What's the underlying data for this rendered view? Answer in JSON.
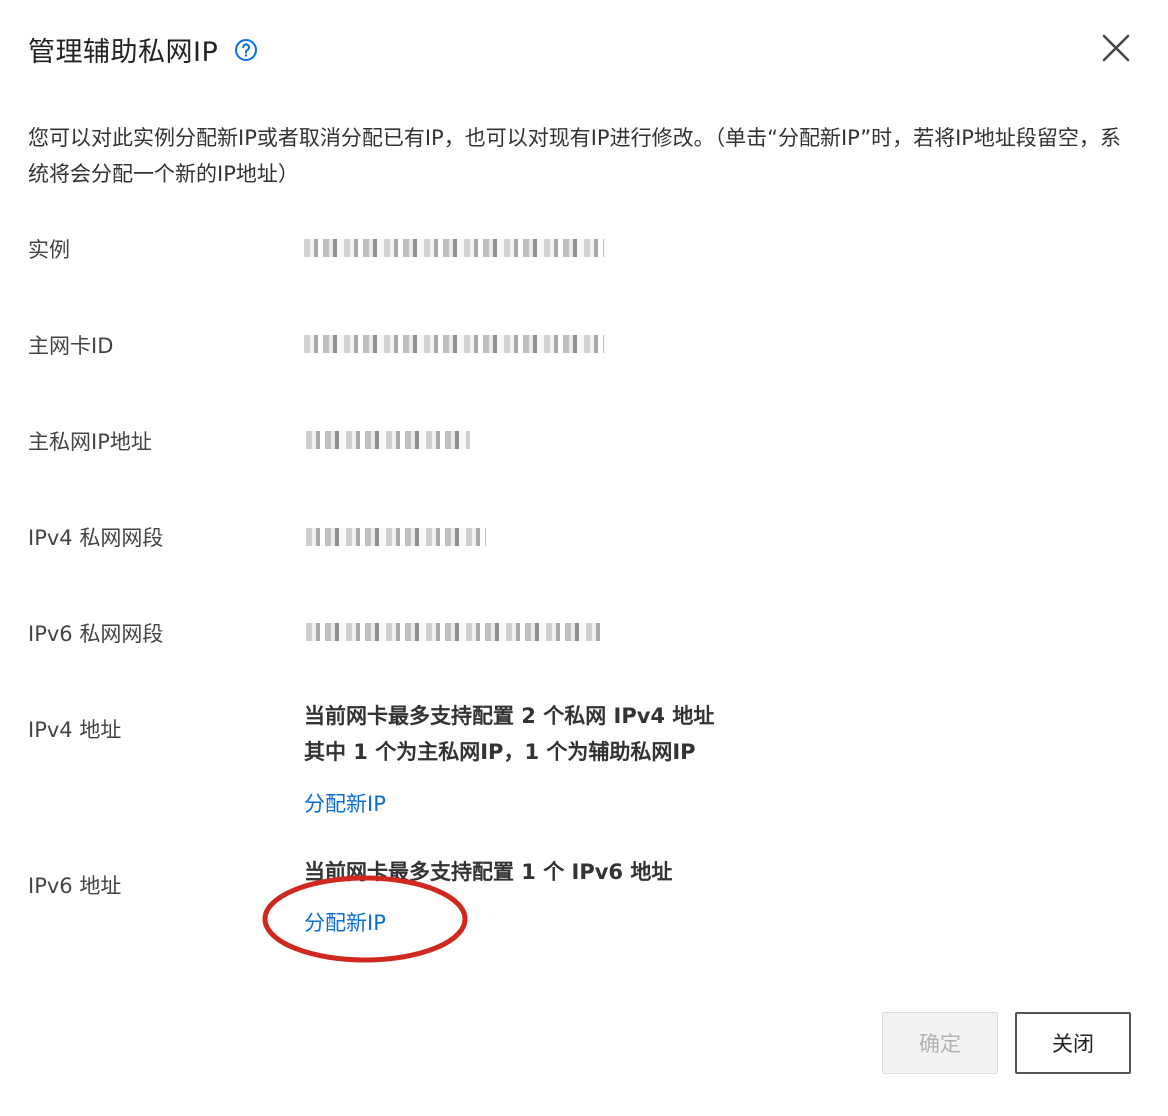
{
  "dialog": {
    "title": "管理辅助私网IP",
    "description": "您可以对此实例分配新IP或者取消分配已有IP，也可以对现有IP进行修改。（单击“分配新IP”时，若将IP地址段留空，系统将会分配一个新的IP地址）",
    "fields": {
      "instance_label": "实例",
      "eni_label": "主网卡ID",
      "primary_ip_label": "主私网IP地址",
      "ipv4_cidr_label": "IPv4 私网网段",
      "ipv6_cidr_label": "IPv6 私网网段",
      "ipv4_addr_label": "IPv4 地址",
      "ipv6_addr_label": "IPv6 地址"
    },
    "ipv4": {
      "line1": "当前网卡最多支持配置 2 个私网 IPv4 地址",
      "line2": "其中 1 个为主私网IP，1 个为辅助私网IP",
      "assign_link": "分配新IP"
    },
    "ipv6": {
      "line1": "当前网卡最多支持配置 1 个 IPv6 地址",
      "assign_link": "分配新IP"
    },
    "buttons": {
      "confirm": "确定",
      "close": "关闭"
    }
  },
  "icons": {
    "help": "question-circle-icon",
    "close": "close-x-icon"
  },
  "colors": {
    "link": "#0a6fd6",
    "annotation_circle": "#d0281e",
    "disabled_button_text": "#b3b3b3"
  }
}
